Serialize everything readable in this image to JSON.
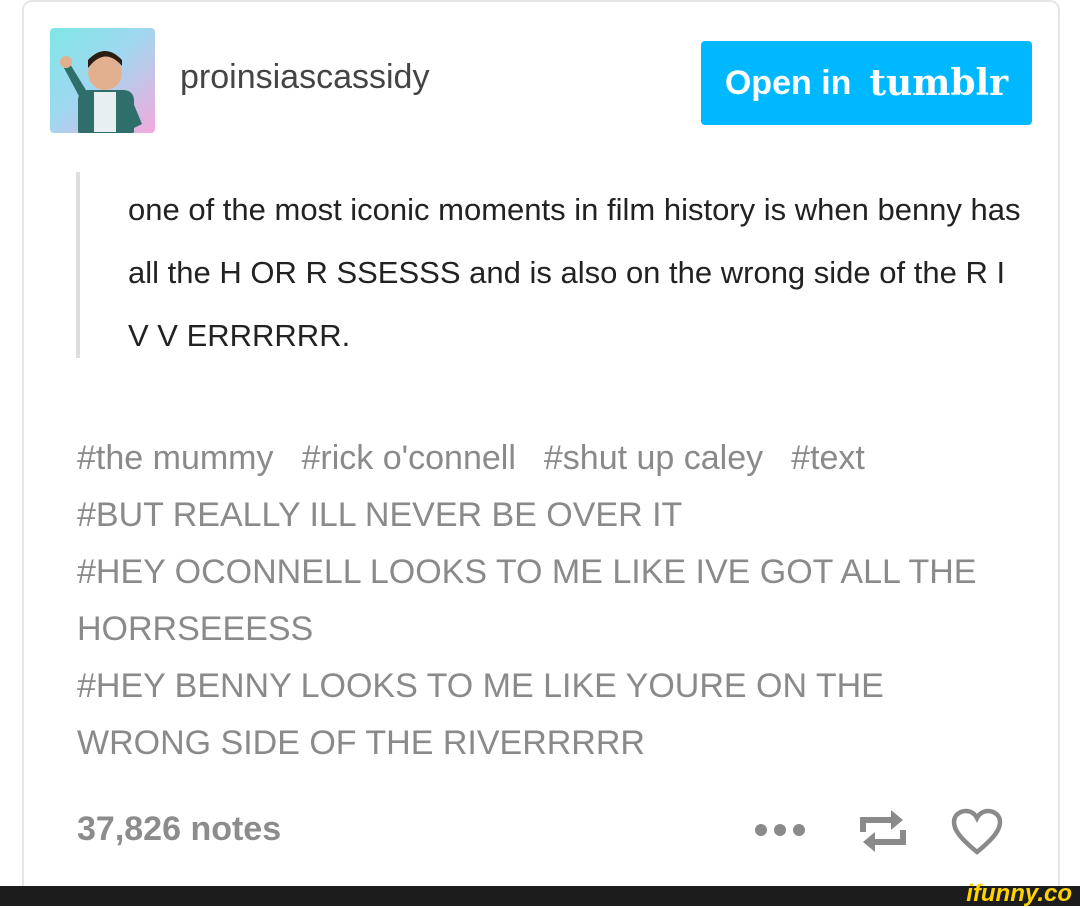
{
  "post": {
    "username": "proinsiascassidy",
    "open_button": {
      "label": "Open in",
      "brand": "tumblr"
    },
    "quote": "one of the most iconic moments in film history is when benny has all the H OR R SSESSS and is also on the wrong side of the R I V V ERRRRRR.",
    "tags": [
      "#the mummy",
      "#rick o'connell",
      "#shut up caley",
      "#text",
      "#BUT REALLY ILL NEVER BE OVER IT",
      "#HEY OCONNELL LOOKS TO ME LIKE IVE GOT ALL THE HORRSEEESS",
      "#HEY BENNY LOOKS TO ME LIKE YOURE ON THE WRONG SIDE OF THE RIVERRRRR"
    ],
    "notes": "37,826 notes",
    "actions": {
      "more_icon": "more-icon",
      "reblog_icon": "reblog-icon",
      "like_icon": "heart-icon"
    }
  },
  "footer": {
    "watermark": "ifunny.co"
  },
  "colors": {
    "accent": "#00b8ff",
    "tag_text": "#8a8a8a",
    "footer_bg": "#1c1c1c",
    "watermark": "#ffd200"
  }
}
